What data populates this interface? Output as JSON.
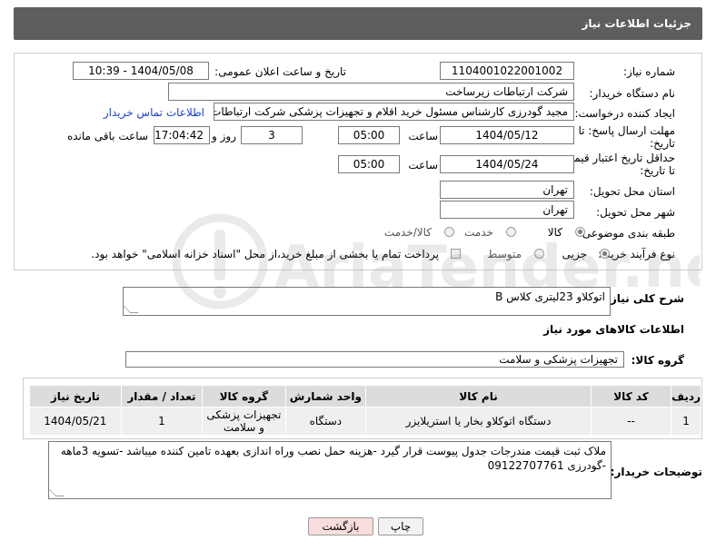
{
  "header": {
    "title": "جزئیات اطلاعات نیاز"
  },
  "form": {
    "need_number": {
      "label": "شماره نیاز:",
      "value": "1104001022001002"
    },
    "announce_datetime": {
      "label": "تاریخ و ساعت اعلان عمومی:",
      "value": "1404/05/08 - 10:39"
    },
    "buyer_org": {
      "label": "نام دستگاه خریدار:",
      "value": "شرکت ارتباطات زیرساخت"
    },
    "requester": {
      "label": "ایجاد کننده درخواست:",
      "value": "مجید گودرزی کارشناس مسئول خرید اقلام و تجهیزات پزشکی شرکت ارتباطات ز",
      "contact_link": "اطلاعات تماس خریدار"
    },
    "reply_deadline": {
      "label_line1": "مهلت ارسال پاسخ: تا",
      "label_line2": "تاریخ:",
      "date": "1404/05/12",
      "time_label": "ساعت",
      "time": "05:00",
      "days": "3",
      "days_label": "روز و",
      "remaining": "17:04:42",
      "remaining_label": "ساعت باقی مانده"
    },
    "price_validity": {
      "label_line1": "حداقل تاریخ اعتبار قیمت:",
      "label_line2": "تا تاریخ:",
      "date": "1404/05/24",
      "time_label": "ساعت",
      "time": "05:00"
    },
    "delivery_province": {
      "label": "استان محل تحویل:",
      "value": "تهران"
    },
    "delivery_city": {
      "label": "شهر محل تحویل:",
      "value": "تهران"
    },
    "category": {
      "label": "طبقه بندی موضوعی:",
      "options": [
        "کالا",
        "خدمت",
        "کالا/خدمت"
      ],
      "selected": "کالا"
    },
    "purchase_process": {
      "label": "نوع فرآیند خرید :",
      "options": [
        "جزیی",
        "متوسط"
      ],
      "selected": "جزیی",
      "payment_note": "پرداخت تمام یا بخشی از مبلغ خرید،از محل \"اسناد خزانه اسلامی\" خواهد بود."
    }
  },
  "need_description": {
    "label": "شرح کلی نیاز:",
    "value": "اتوکلاو 23لیتری کلاس B"
  },
  "goods_info": {
    "title": "اطلاعات کالاهای مورد نیاز",
    "group_label": "گروه کالا:",
    "group_value": "تجهیزات پزشکی و سلامت",
    "columns": [
      "ردیف",
      "کد کالا",
      "نام کالا",
      "واحد شمارش",
      "گروه کالا",
      "تعداد / مقدار",
      "تاریخ نیاز"
    ],
    "rows": [
      [
        "1",
        "--",
        "دستگاه اتوکلاو بخار یا استریلایزر",
        "دستگاه",
        "تجهیزات پزشکی و سلامت",
        "1",
        "1404/05/21"
      ]
    ]
  },
  "buyer_notes": {
    "label": "توضیحات خریدار:",
    "value": "ملاک ثبت قیمت مندرجات جدول پیوست قرار گیرد -هزینه حمل نصب وراه اندازی بعهده تامین کننده میباشد -تسویه 3ماهه -گودرزی 09122707761"
  },
  "buttons": {
    "print": "چاپ",
    "back": "بازگشت"
  },
  "watermark": {
    "text": "AriaTender.net"
  },
  "colors": {
    "header_bg": "#5e5e5e",
    "link": "#1a3fd6",
    "back_button_bg": "#f9dcdc",
    "table_header_bg": "#dcdcdc"
  }
}
